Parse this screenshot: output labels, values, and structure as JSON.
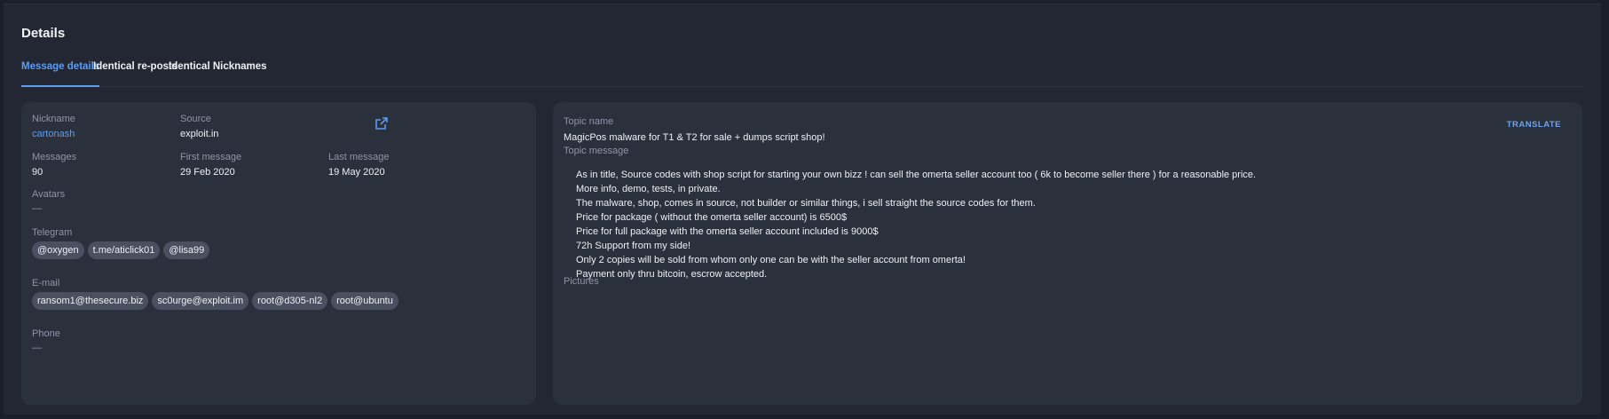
{
  "header": {
    "title": "Details"
  },
  "tabs": [
    {
      "label": "Message details"
    },
    {
      "label": "Identical re-posts"
    },
    {
      "label": "Identical Nicknames"
    }
  ],
  "profile": {
    "nickname_label": "Nickname",
    "nickname": "cartonash",
    "source_label": "Source",
    "source": "exploit.in",
    "messages_label": "Messages",
    "messages": "90",
    "first_message_label": "First message",
    "first_message": "29 Feb 2020",
    "last_message_label": "Last message",
    "last_message": "19 May 2020",
    "avatars_label": "Avatars",
    "avatars": "—",
    "telegram_label": "Telegram",
    "telegram": [
      "@oxygen",
      "t.me/aticlick01",
      "@lisa99"
    ],
    "email_label": "E-mail",
    "emails": [
      "ransom1@thesecure.biz",
      "sc0urge@exploit.im",
      "root@d305-nl2",
      "root@ubuntu"
    ],
    "phone_label": "Phone",
    "phone": "—"
  },
  "topic": {
    "name_label": "Topic name",
    "name": "MagicPos malware for T1 & T2 for sale + dumps script shop!",
    "translate_label": "TRANSLATE",
    "message_label": "Topic message",
    "message_lines": [
      "As in title, Source codes with shop script for starting your own bizz ! can sell the omerta seller account too ( 6k to become seller there ) for a reasonable price.",
      "More info, demo, tests, in private.",
      "The malware, shop, comes in source, not builder or similar things, i sell straight the source codes for them.",
      "Price for package ( without the omerta seller account) is 6500$",
      "Price for full package with the omerta seller account included is 9000$",
      "72h Support from my side!",
      "Only 2 copies will be sold from whom only one can be with the seller account from omerta!",
      "Payment only thru bitcoin, escrow accepted."
    ],
    "pictures_label": "Pictures"
  },
  "icons": {
    "external_link": "external-link-icon"
  },
  "colors": {
    "accent": "#5d9cf0",
    "background": "#232733",
    "card": "#2b303d",
    "chip": "#4a5060"
  }
}
